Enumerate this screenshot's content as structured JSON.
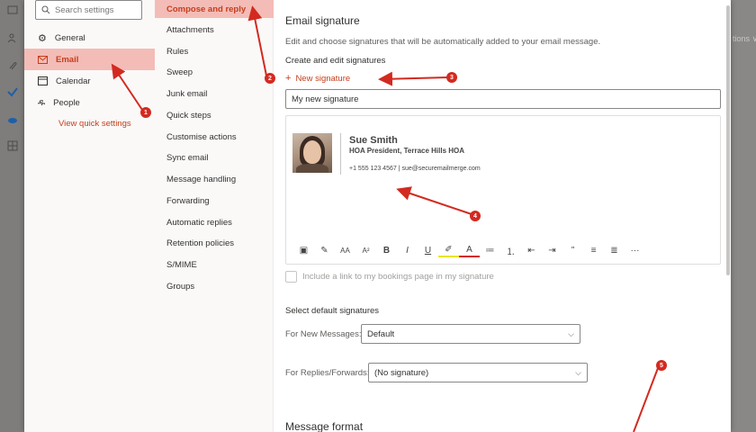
{
  "background": {
    "right_fade_text": "tions ∨"
  },
  "sidebar1": {
    "search_placeholder": "Search settings",
    "items": [
      {
        "label": "General",
        "icon": "gear-icon"
      },
      {
        "label": "Email",
        "icon": "mail-icon",
        "selected": true
      },
      {
        "label": "Calendar",
        "icon": "calendar-icon"
      },
      {
        "label": "People",
        "icon": "people-icon"
      }
    ],
    "quick_link": "View quick settings"
  },
  "sidebar2": {
    "items": [
      {
        "label": "Compose and reply",
        "selected": true
      },
      {
        "label": "Attachments"
      },
      {
        "label": "Rules"
      },
      {
        "label": "Sweep"
      },
      {
        "label": "Junk email"
      },
      {
        "label": "Quick steps"
      },
      {
        "label": "Customise actions"
      },
      {
        "label": "Sync email"
      },
      {
        "label": "Message handling"
      },
      {
        "label": "Forwarding"
      },
      {
        "label": "Automatic replies"
      },
      {
        "label": "Retention policies"
      },
      {
        "label": "S/MIME"
      },
      {
        "label": "Groups"
      }
    ]
  },
  "main": {
    "heading": "Email signature",
    "description": "Edit and choose signatures that will be automatically added to your email message.",
    "subheading": "Create and edit signatures",
    "new_signature": "New signature",
    "signature_name": "My new signature",
    "signature": {
      "name": "Sue Smith",
      "title": "HOA President, Terrace Hills HOA",
      "contact": "+1 555 123 4567  |  sue@securemailmerge.com"
    },
    "toolbar_icons": [
      "image-icon",
      "format-painter-icon",
      "font-size-icon",
      "grow-font-icon",
      "bold-icon",
      "italic-icon",
      "underline-icon",
      "highlight-icon",
      "font-color-icon",
      "bullets-icon",
      "numbering-icon",
      "decrease-indent-icon",
      "increase-indent-icon",
      "quote-icon",
      "align-left-icon",
      "align-center-icon",
      "more-icon"
    ],
    "toolbar_glyphs": [
      "▣",
      "✎",
      "AA",
      "A²",
      "B",
      "I",
      "U",
      "✐",
      "A",
      "≔",
      "⒈",
      "⇤",
      "⇥",
      "”",
      "≡",
      "≣",
      "···"
    ],
    "bookings_checkbox": "Include a link to my bookings page in my signature",
    "defaults_heading": "Select default signatures",
    "new_messages_label": "For New Messages:",
    "new_messages_value": "Default",
    "replies_label": "For Replies/Forwards:",
    "replies_value": "(No signature)",
    "message_format": "Message format"
  },
  "annotations": {
    "badges": [
      "1",
      "2",
      "3",
      "4",
      "5"
    ],
    "arrow_color": "#d32a20"
  },
  "colors": {
    "accent": "#c43e1c",
    "selected_bg": "#f4bcb6"
  }
}
